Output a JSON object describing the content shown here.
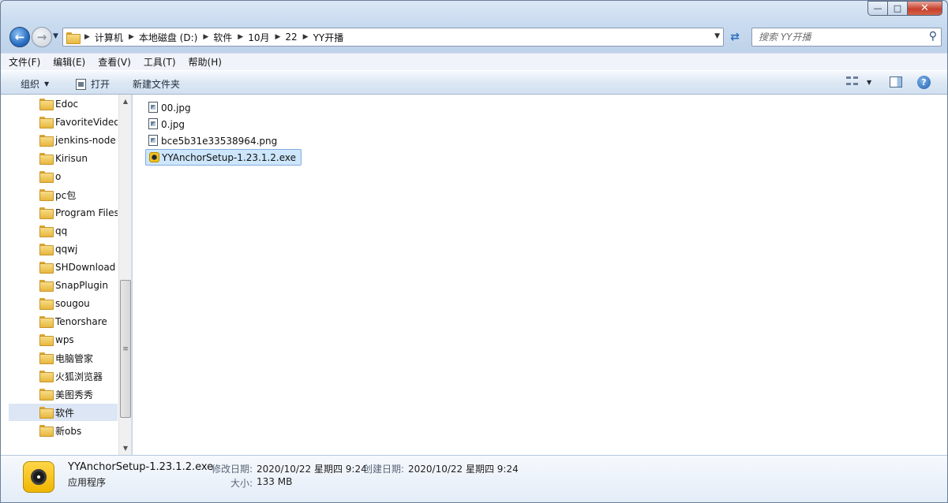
{
  "window": {
    "minimize": "—",
    "maximize": "□",
    "close": "✕"
  },
  "nav": {
    "back_icon": "←",
    "forward_icon": "→",
    "breadcrumbs": [
      "计算机",
      "本地磁盘 (D:)",
      "软件",
      "10月",
      "22",
      "YY开播"
    ],
    "search_placeholder": "搜索 YY开播"
  },
  "menu": [
    "文件(F)",
    "编辑(E)",
    "查看(V)",
    "工具(T)",
    "帮助(H)"
  ],
  "toolbar": {
    "organize": "组织",
    "open": "打开",
    "new_folder": "新建文件夹",
    "help": "?"
  },
  "sidebar": {
    "items": [
      {
        "label": "Edoc"
      },
      {
        "label": "FavoriteVideo"
      },
      {
        "label": "jenkins-node"
      },
      {
        "label": "Kirisun"
      },
      {
        "label": "o"
      },
      {
        "label": "pc包"
      },
      {
        "label": "Program Files"
      },
      {
        "label": "qq"
      },
      {
        "label": "qqwj"
      },
      {
        "label": "SHDownload"
      },
      {
        "label": "SnapPlugin"
      },
      {
        "label": "sougou"
      },
      {
        "label": "Tenorshare"
      },
      {
        "label": "wps"
      },
      {
        "label": "电脑管家"
      },
      {
        "label": "火狐浏览器"
      },
      {
        "label": "美图秀秀"
      },
      {
        "label": "软件",
        "selected": true
      },
      {
        "label": "新obs"
      }
    ]
  },
  "files": [
    {
      "name": "00.jpg",
      "icon": "image-file-icon"
    },
    {
      "name": "0.jpg",
      "icon": "image-file-icon"
    },
    {
      "name": "bce5b31e33538964.png",
      "icon": "image-file-icon"
    },
    {
      "name": "YYAnchorSetup-1.23.1.2.exe",
      "icon": "yy-exe-icon",
      "selected": true
    }
  ],
  "details": {
    "name": "YYAnchorSetup-1.23.1.2.exe",
    "type": "应用程序",
    "modified_label": "修改日期:",
    "modified_value": "2020/10/22 星期四 9:24",
    "created_label": "创建日期:",
    "created_value": "2020/10/22 星期四 9:24",
    "size_label": "大小:",
    "size_value": "133 MB"
  }
}
